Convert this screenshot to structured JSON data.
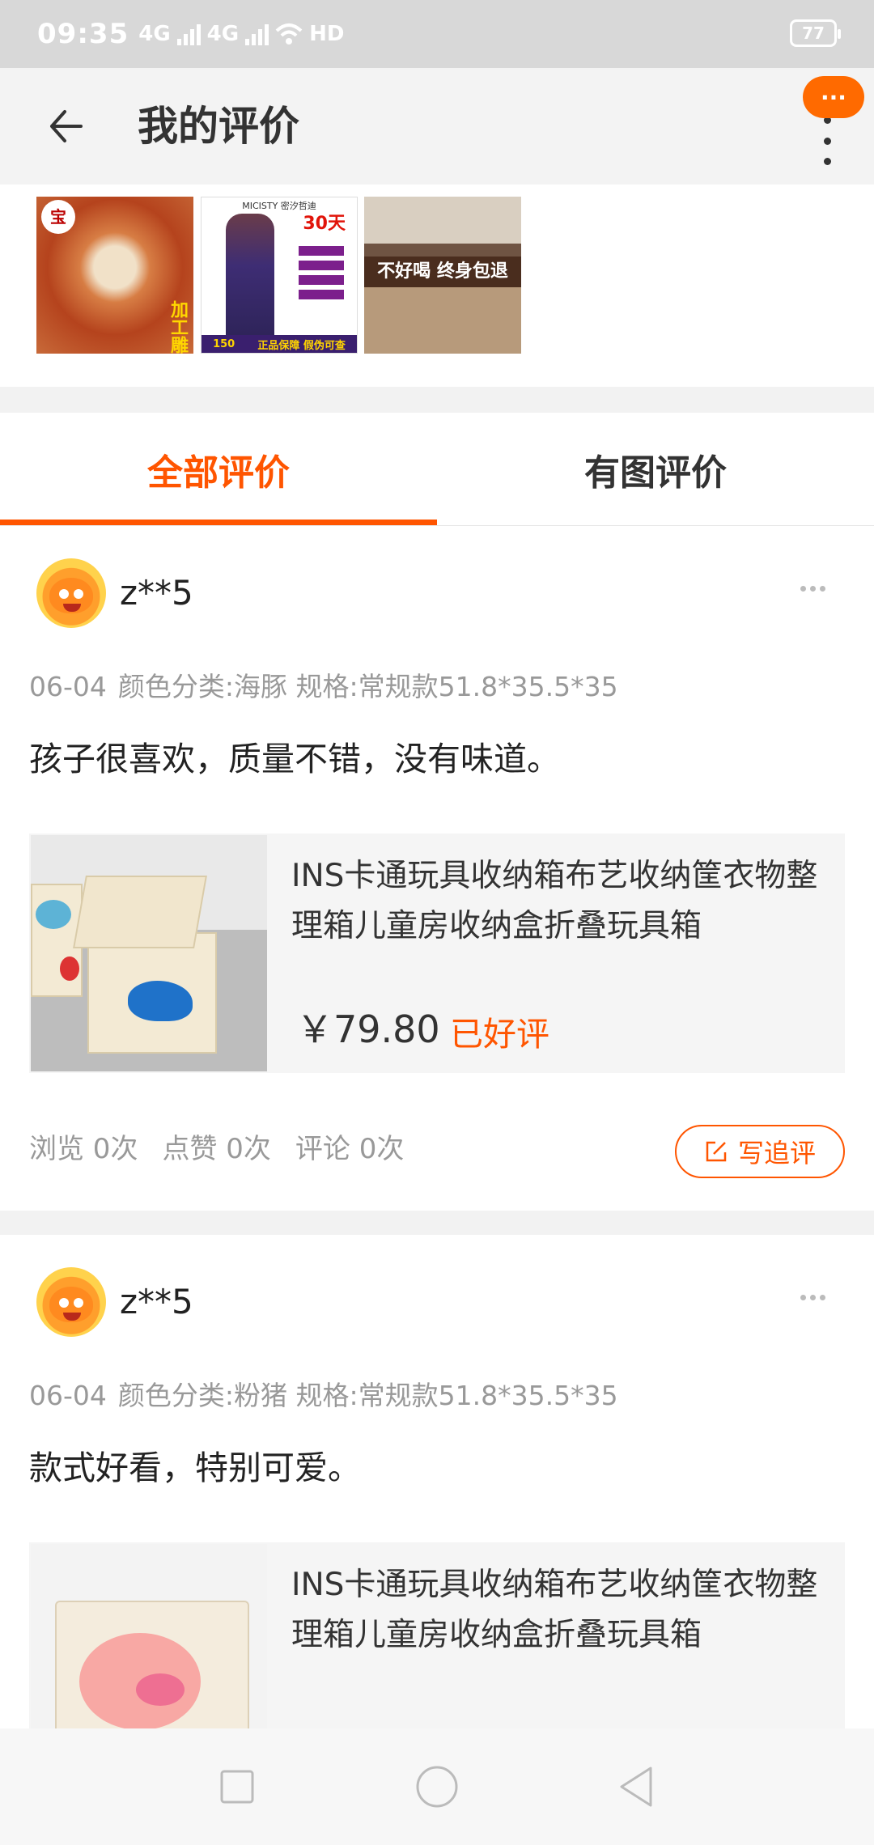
{
  "status_bar": {
    "time": "09:35",
    "network_1": "4G",
    "network_2": "4G",
    "wifi_label": "HD",
    "battery": "77"
  },
  "header": {
    "title": "我的评价",
    "back_icon": "back-arrow-icon",
    "more_icon": "more-vertical-icon",
    "message_badge": "···"
  },
  "image_strip": {
    "thumb1_text": "加工雕",
    "thumb1_logo": "宝",
    "thumb2_brand": "MICISTY 密汐哲迪",
    "thumb2_badge": "30天",
    "thumb2_bottom_left": "150",
    "thumb2_bottom_right": "正品保障 假伪可查",
    "thumb3_banner": "不好喝 终身包退"
  },
  "tabs": [
    {
      "label": "全部评价",
      "active": true
    },
    {
      "label": "有图评价",
      "active": false
    }
  ],
  "reviews": [
    {
      "username": "z**5",
      "date": "06-04",
      "spec": "颜色分类:海豚 规格:常规款51.8*35.5*35",
      "text": "孩子很喜欢，质量不错，没有味道。",
      "product_title": "INS卡通玩具收纳箱布艺收纳筐衣物整理箱儿童房收纳盒折叠玩具箱",
      "price": "￥79.80",
      "status": "已好评",
      "views": "浏览 0次",
      "likes": "点赞 0次",
      "comments": "评论 0次",
      "write_label": "写追评"
    },
    {
      "username": "z**5",
      "date": "06-04",
      "spec": "颜色分类:粉猪 规格:常规款51.8*35.5*35",
      "text": "款式好看，特别可爱。",
      "product_title": "INS卡通玩具收纳箱布艺收纳筐衣物整理箱儿童房收纳盒折叠玩具箱"
    }
  ],
  "nav_bar": {
    "items": [
      "recent-apps-icon",
      "home-icon",
      "back-triangle-icon"
    ]
  },
  "colors": {
    "accent": "#ff5500",
    "badge": "#ff6a00",
    "muted_text": "#999999"
  }
}
